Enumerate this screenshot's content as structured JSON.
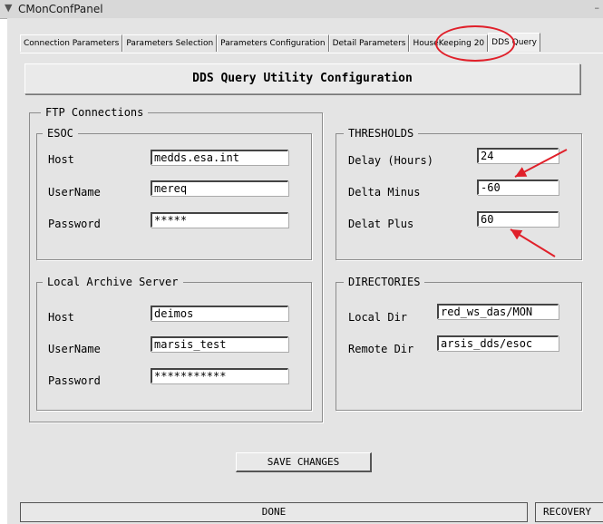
{
  "window": {
    "title": "CMonConfPanel"
  },
  "tabs": [
    {
      "label": "Connection Parameters"
    },
    {
      "label": "Parameters Selection"
    },
    {
      "label": "Parameters Configuration"
    },
    {
      "label": "Detail Parameters"
    },
    {
      "label": "HouseKeeping 20"
    },
    {
      "label": "DDS Query"
    }
  ],
  "active_tab": "DDS Query",
  "header": {
    "title": "DDS Query Utility Configuration"
  },
  "ftp": {
    "label": "FTP Connections",
    "esoc": {
      "label": "ESOC",
      "host_label": "Host",
      "host": "medds.esa.int",
      "user_label": "UserName",
      "user": "mereq",
      "pass_label": "Password",
      "pass": "*****"
    }
  },
  "local": {
    "label": "Local Archive Server",
    "host_label": "Host",
    "host": "deimos",
    "user_label": "UserName",
    "user": "marsis_test",
    "pass_label": "Password",
    "pass": "***********"
  },
  "thresholds": {
    "label": "THRESHOLDS",
    "delay_label": "Delay (Hours)",
    "delay": "24",
    "minus_label": "Delta Minus",
    "minus": "-60",
    "plus_label": "Delat Plus",
    "plus": "60"
  },
  "directories": {
    "label": "DIRECTORIES",
    "local_label": "Local Dir",
    "local": "red_ws_das/MON",
    "remote_label": "Remote Dir",
    "remote": "arsis_dds/esoc"
  },
  "save_button": "SAVE CHANGES",
  "status": {
    "text": "DONE",
    "recovery": "RECOVERY"
  },
  "colors": {
    "annotation": "#e0202a",
    "panel": "#e4e4e4"
  }
}
